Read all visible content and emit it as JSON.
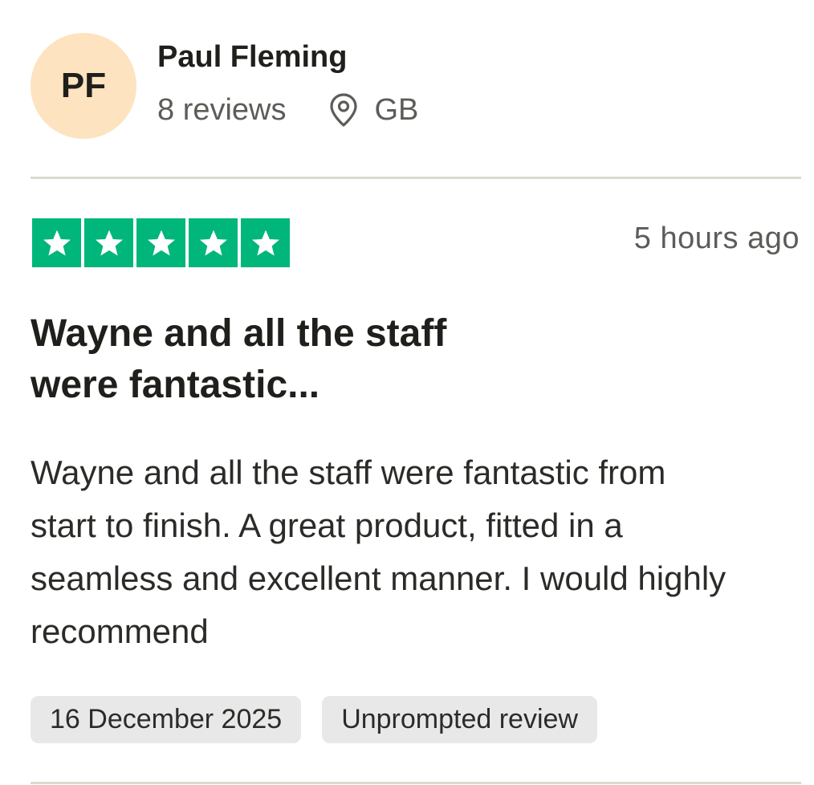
{
  "reviewer": {
    "initials": "PF",
    "name": "Paul Fleming",
    "reviews_count": "8 reviews",
    "location": "GB",
    "location_icon": "map-pin-icon",
    "avatar_color": "#fde3bf"
  },
  "review": {
    "rating": 5,
    "rating_max": 5,
    "star_color": "#00b67a",
    "time_ago": "5 hours ago",
    "title": "Wayne and all the staff were fantastic...",
    "body": "Wayne and all the staff were fantastic from start to finish. A great product, fitted in a seamless and excellent manner. I would highly recommend",
    "date": "16 December 2025",
    "tag": "Unprompted review"
  }
}
